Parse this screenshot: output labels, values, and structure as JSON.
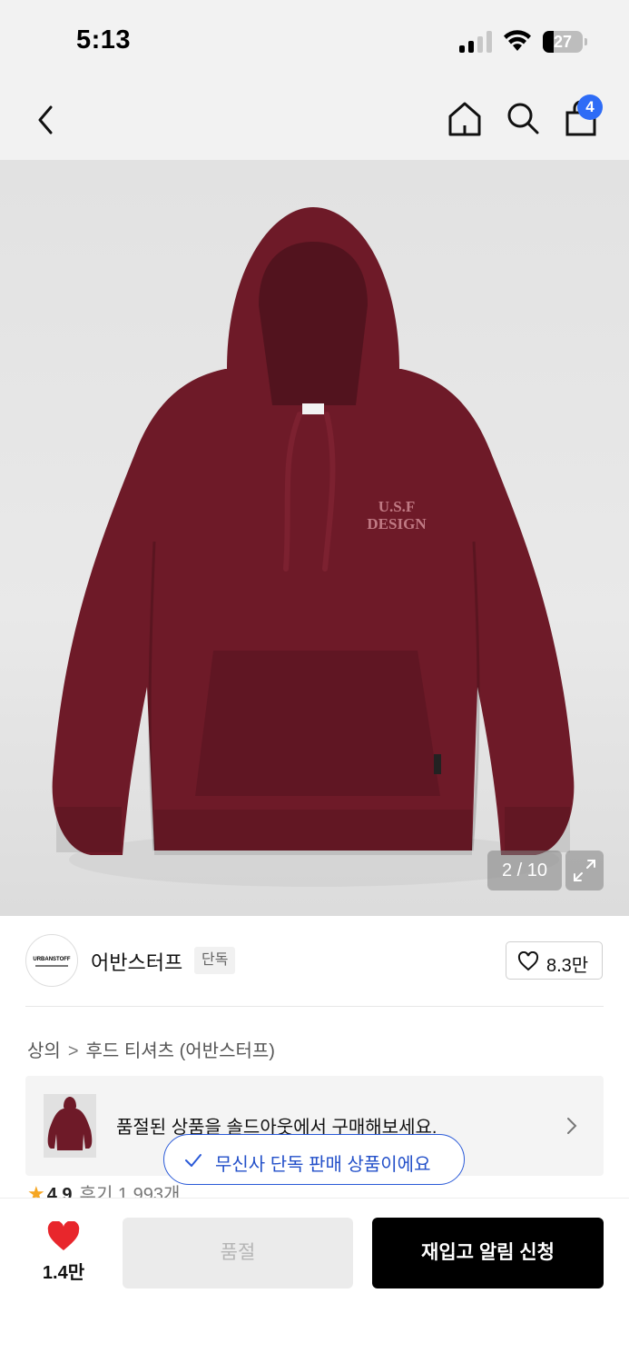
{
  "status_bar": {
    "time": "5:13",
    "battery_level": "27",
    "battery_fraction": 0.27,
    "icons": [
      "signal-icon",
      "wifi-icon",
      "battery-icon"
    ]
  },
  "nav": {
    "icons": [
      "back-icon",
      "home-icon",
      "search-icon",
      "cart-icon"
    ],
    "cart_badge": "4"
  },
  "gallery": {
    "counter": "2 / 10",
    "print_text_line1": "U.S.F",
    "print_text_line2": "DESIGN",
    "product_color": "#6e1a28"
  },
  "brand": {
    "logo_text": "URBANSTOFF",
    "name": "어반스터프",
    "tag": "단독",
    "like_count": "8.3만"
  },
  "breadcrumb": {
    "category": "상의",
    "subcategory": "후드 티셔츠 (어반스터프)"
  },
  "soldout_banner": {
    "text": "품절된 상품을 솔드아웃에서 구매해보세요."
  },
  "review": {
    "rating": "4.9",
    "count_label": "후기 1,993개"
  },
  "exclusive_pill": {
    "text": "무신사 단독 판매 상품이에요",
    "accent": "#2a5ad8"
  },
  "bottom_bar": {
    "like_count": "1.4만",
    "soldout_label": "품절",
    "restock_label": "재입고 알림 신청",
    "heart_color": "#e8262c"
  }
}
